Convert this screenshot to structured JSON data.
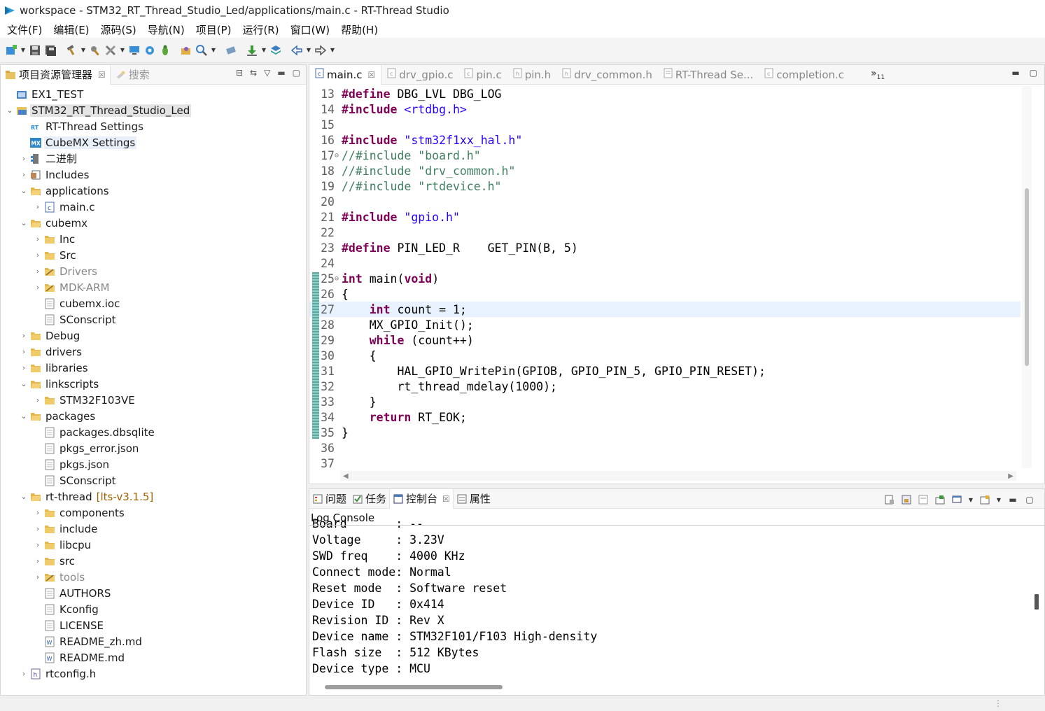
{
  "window": {
    "title": "workspace - STM32_RT_Thread_Studio_Led/applications/main.c - RT-Thread Studio"
  },
  "menu": [
    "文件(F)",
    "编辑(E)",
    "源码(S)",
    "导航(N)",
    "项目(P)",
    "运行(R)",
    "窗口(W)",
    "帮助(H)"
  ],
  "left_panel": {
    "tab_active": "项目资源管理器",
    "tab_inactive": "搜索"
  },
  "tree": [
    {
      "label": "EX1_TEST",
      "depth": 0,
      "arrow": "",
      "icon": "project-icon"
    },
    {
      "label": "STM32_RT_Thread_Studio_Led",
      "depth": 0,
      "arrow": "open",
      "icon": "project-open-icon",
      "state": "sel"
    },
    {
      "label": "RT-Thread Settings",
      "depth": 1,
      "arrow": "",
      "icon": "rt-settings-icon"
    },
    {
      "label": "CubeMX Settings",
      "depth": 1,
      "arrow": "",
      "icon": "cubemx-settings-icon",
      "state": "hl"
    },
    {
      "label": "二进制",
      "depth": 1,
      "arrow": "closed",
      "icon": "binaries-icon"
    },
    {
      "label": "Includes",
      "depth": 1,
      "arrow": "closed",
      "icon": "includes-icon"
    },
    {
      "label": "applications",
      "depth": 1,
      "arrow": "open",
      "icon": "folder-open-icon"
    },
    {
      "label": "main.c",
      "depth": 2,
      "arrow": "closed",
      "icon": "c-file-icon"
    },
    {
      "label": "cubemx",
      "depth": 1,
      "arrow": "open",
      "icon": "folder-open-icon"
    },
    {
      "label": "Inc",
      "depth": 2,
      "arrow": "closed",
      "icon": "folder-icon"
    },
    {
      "label": "Src",
      "depth": 2,
      "arrow": "closed",
      "icon": "folder-icon"
    },
    {
      "label": "Drivers",
      "depth": 2,
      "arrow": "closed",
      "icon": "folder-excluded-icon",
      "state": "dim"
    },
    {
      "label": "MDK-ARM",
      "depth": 2,
      "arrow": "closed",
      "icon": "folder-excluded-icon",
      "state": "dim"
    },
    {
      "label": "cubemx.ioc",
      "depth": 2,
      "arrow": "",
      "icon": "file-icon"
    },
    {
      "label": "SConscript",
      "depth": 2,
      "arrow": "",
      "icon": "file-icon"
    },
    {
      "label": "Debug",
      "depth": 1,
      "arrow": "closed",
      "icon": "folder-icon"
    },
    {
      "label": "drivers",
      "depth": 1,
      "arrow": "closed",
      "icon": "folder-icon"
    },
    {
      "label": "libraries",
      "depth": 1,
      "arrow": "closed",
      "icon": "folder-icon"
    },
    {
      "label": "linkscripts",
      "depth": 1,
      "arrow": "open",
      "icon": "folder-open-icon"
    },
    {
      "label": "STM32F103VE",
      "depth": 2,
      "arrow": "closed",
      "icon": "folder-icon"
    },
    {
      "label": "packages",
      "depth": 1,
      "arrow": "open",
      "icon": "folder-open-icon"
    },
    {
      "label": "packages.dbsqlite",
      "depth": 2,
      "arrow": "",
      "icon": "file-icon"
    },
    {
      "label": "pkgs_error.json",
      "depth": 2,
      "arrow": "",
      "icon": "file-icon"
    },
    {
      "label": "pkgs.json",
      "depth": 2,
      "arrow": "",
      "icon": "file-icon"
    },
    {
      "label": "SConscript",
      "depth": 2,
      "arrow": "",
      "icon": "file-icon"
    },
    {
      "label": "rt-thread",
      "depth": 1,
      "arrow": "open",
      "icon": "folder-open-icon",
      "suffix": "[lts-v3.1.5]"
    },
    {
      "label": "components",
      "depth": 2,
      "arrow": "closed",
      "icon": "folder-icon"
    },
    {
      "label": "include",
      "depth": 2,
      "arrow": "closed",
      "icon": "folder-icon"
    },
    {
      "label": "libcpu",
      "depth": 2,
      "arrow": "closed",
      "icon": "folder-icon"
    },
    {
      "label": "src",
      "depth": 2,
      "arrow": "closed",
      "icon": "folder-icon"
    },
    {
      "label": "tools",
      "depth": 2,
      "arrow": "closed",
      "icon": "folder-excluded-icon",
      "state": "dim"
    },
    {
      "label": "AUTHORS",
      "depth": 2,
      "arrow": "",
      "icon": "file-icon"
    },
    {
      "label": "Kconfig",
      "depth": 2,
      "arrow": "",
      "icon": "file-icon"
    },
    {
      "label": "LICENSE",
      "depth": 2,
      "arrow": "",
      "icon": "file-icon"
    },
    {
      "label": "README_zh.md",
      "depth": 2,
      "arrow": "",
      "icon": "markdown-file-icon"
    },
    {
      "label": "README.md",
      "depth": 2,
      "arrow": "",
      "icon": "markdown-file-icon"
    },
    {
      "label": "rtconfig.h",
      "depth": 1,
      "arrow": "closed",
      "icon": "h-file-icon"
    }
  ],
  "editor": {
    "tabs": [
      {
        "label": "main.c",
        "active": true,
        "closable": true
      },
      {
        "label": "drv_gpio.c"
      },
      {
        "label": "pin.c"
      },
      {
        "label": "pin.h"
      },
      {
        "label": "drv_common.h"
      },
      {
        "label": "RT-Thread Se..."
      },
      {
        "label": "completion.c"
      }
    ],
    "more_tabs": "»",
    "more_count": "11",
    "current_line": 27,
    "changed_lines": [
      25,
      35
    ],
    "lines": [
      {
        "n": 13,
        "parts": [
          [
            "kw",
            "#define"
          ],
          [
            "",
            " DBG_LVL DBG_LOG"
          ]
        ]
      },
      {
        "n": 14,
        "parts": [
          [
            "kw",
            "#include"
          ],
          [
            "",
            " "
          ],
          [
            "str",
            "<rtdbg.h>"
          ]
        ]
      },
      {
        "n": 15,
        "parts": []
      },
      {
        "n": 16,
        "parts": [
          [
            "kw",
            "#include"
          ],
          [
            "",
            " "
          ],
          [
            "str",
            "\"stm32f1xx_hal.h\""
          ]
        ]
      },
      {
        "n": 17,
        "fold": true,
        "parts": [
          [
            "cmt",
            "//#include \"board.h\""
          ]
        ]
      },
      {
        "n": 18,
        "parts": [
          [
            "cmt",
            "//#include \"drv_common.h\""
          ]
        ]
      },
      {
        "n": 19,
        "parts": [
          [
            "cmt",
            "//#include \"rtdevice.h\""
          ]
        ]
      },
      {
        "n": 20,
        "parts": []
      },
      {
        "n": 21,
        "parts": [
          [
            "kw",
            "#include"
          ],
          [
            "",
            " "
          ],
          [
            "str",
            "\"gpio.h\""
          ]
        ]
      },
      {
        "n": 22,
        "parts": []
      },
      {
        "n": 23,
        "parts": [
          [
            "kw",
            "#define"
          ],
          [
            "",
            " PIN_LED_R    GET_PIN(B, 5)"
          ]
        ]
      },
      {
        "n": 24,
        "parts": []
      },
      {
        "n": 25,
        "fold": true,
        "parts": [
          [
            "kw",
            "int"
          ],
          [
            "",
            " "
          ],
          [
            "fn",
            "main"
          ],
          [
            "",
            "("
          ],
          [
            "kw",
            "void"
          ],
          [
            "",
            ")"
          ]
        ]
      },
      {
        "n": 26,
        "parts": [
          [
            "",
            "{"
          ]
        ]
      },
      {
        "n": 27,
        "parts": [
          [
            "",
            "    "
          ],
          [
            "kw",
            "int"
          ],
          [
            "",
            " count = 1;"
          ]
        ]
      },
      {
        "n": 28,
        "parts": [
          [
            "",
            "    MX_GPIO_Init();"
          ]
        ]
      },
      {
        "n": 29,
        "parts": [
          [
            "",
            "    "
          ],
          [
            "kw",
            "while"
          ],
          [
            "",
            " (count++)"
          ]
        ]
      },
      {
        "n": 30,
        "parts": [
          [
            "",
            "    {"
          ]
        ]
      },
      {
        "n": 31,
        "parts": [
          [
            "",
            "        HAL_GPIO_WritePin(GPIOB, GPIO_PIN_5, GPIO_PIN_RESET);"
          ]
        ]
      },
      {
        "n": 32,
        "parts": [
          [
            "",
            "        rt_thread_mdelay(1000);"
          ]
        ]
      },
      {
        "n": 33,
        "parts": [
          [
            "",
            "    }"
          ]
        ]
      },
      {
        "n": 34,
        "parts": [
          [
            "",
            "    "
          ],
          [
            "kw",
            "return"
          ],
          [
            "",
            " RT_EOK;"
          ]
        ]
      },
      {
        "n": 35,
        "parts": [
          [
            "",
            "}"
          ]
        ]
      },
      {
        "n": 36,
        "parts": []
      },
      {
        "n": 37,
        "parts": []
      }
    ]
  },
  "console": {
    "tabs": [
      {
        "label": "问题",
        "icon": "problems-icon"
      },
      {
        "label": "任务",
        "icon": "tasks-icon"
      },
      {
        "label": "控制台",
        "icon": "console-icon",
        "active": true
      },
      {
        "label": "属性",
        "icon": "properties-icon"
      }
    ],
    "name": "Log Console",
    "lines": [
      "Board       : --",
      "Voltage     : 3.23V",
      "SWD freq    : 4000 KHz",
      "Connect mode: Normal",
      "Reset mode  : Software reset",
      "Device ID   : 0x414",
      "Revision ID : Rev X",
      "Device name : STM32F101/F103 High-density",
      "Flash size  : 512 KBytes",
      "Device type : MCU"
    ]
  },
  "colors": {
    "keyword": "#7f0055",
    "string": "#2a00ff",
    "comment": "#3f7f5f",
    "current_line": "#e8f2fe"
  }
}
